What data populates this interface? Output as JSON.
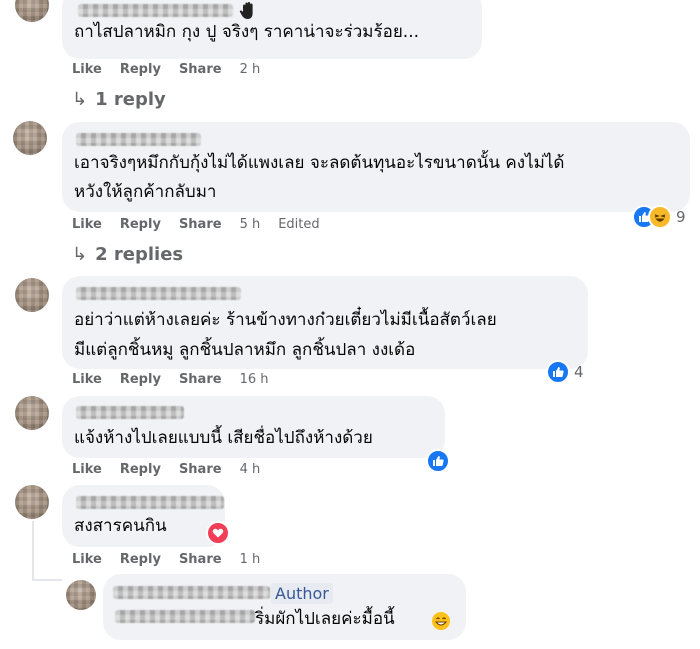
{
  "action_labels": {
    "like": "Like",
    "reply": "Reply",
    "share": "Share"
  },
  "comments": [
    {
      "text_lines": [
        "ถาไสปลาหมิก กุง ปู จริงๆ ราคาน่าจะร่วมร้อย..."
      ],
      "time": "2 h",
      "replies_label": "1 reply",
      "has_hand_icon": true
    },
    {
      "text_lines": [
        "เอาจริงๆหมึกกับกุ้งไม่ได้แพงเลย จะลดต้นทุนอะไรขนาดนั้น คงไม่ได้",
        "หวังให้ลูกค้ากลับมา"
      ],
      "time": "5 h",
      "edited": "Edited",
      "reactions": [
        "like",
        "haha"
      ],
      "reaction_count": "9",
      "replies_label": "2 replies"
    },
    {
      "text_lines": [
        "อย่าว่าแต่ห้างเลยค่ะ ร้านข้างทางก๋วยเตี๋ยวไม่มีเนื้อสัตว์เลย",
        "มีแต่ลูกชิ้นหมู ลูกชิ้นปลาหมึก ลูกชิ้นปลา งงเด้อ"
      ],
      "time": "16 h",
      "reactions": [
        "like"
      ],
      "reaction_count": "4"
    },
    {
      "text_lines": [
        "แจ้งห้างไปเลยแบบนี้ เสียชื่อไปถึงห้างด้วย"
      ],
      "time": "4 h",
      "reactions": [
        "like"
      ]
    },
    {
      "text_lines": [
        "สงสารคนกิน"
      ],
      "time": "1 h",
      "reactions": [
        "love"
      ]
    }
  ],
  "author_reply": {
    "badge": "Author",
    "text": "ริ่มผักไปเลยค่ะมื้อนี้",
    "emoji": "grinning-face-icon"
  },
  "colors": {
    "bubble": "#f0f2f5",
    "meta": "#65676b",
    "like_blue": "#1877f2",
    "love_red": "#f33e58",
    "haha_yellow": "#f7b928",
    "author_blue": "#385898"
  }
}
